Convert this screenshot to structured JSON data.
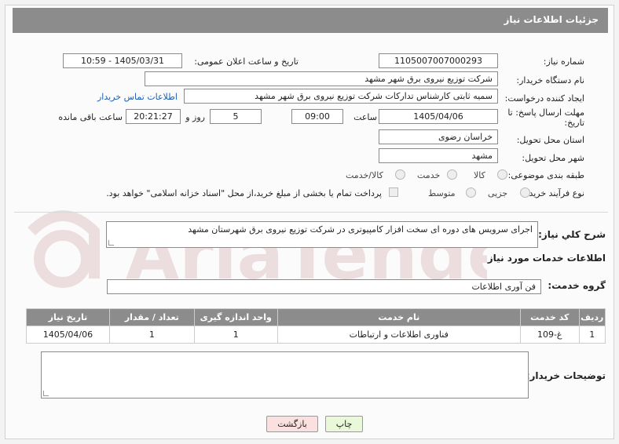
{
  "header": {
    "title": "جزئیات اطلاعات نیاز"
  },
  "info": {
    "need_number_label": "شماره نیاز:",
    "need_number": "1105007007000293",
    "announce_label": "تاریخ و ساعت اعلان عمومی:",
    "announce_value": "1405/03/31 - 10:59",
    "buyer_org_label": "نام دستگاه خریدار:",
    "buyer_org": "شرکت توزیع نیروی برق شهر مشهد",
    "creator_label": "ایجاد کننده درخواست:",
    "creator": "سمیه ثابتی کارشناس تدارکات شرکت توزیع نیروی برق شهر مشهد",
    "contact_link": "اطلاعات تماس خریدار",
    "deadline_label_1": "مهلت ارسال پاسخ: تا",
    "deadline_label_2": "تاریخ:",
    "deadline_date": "1405/04/06",
    "time_label": "ساعت",
    "deadline_time": "09:00",
    "days_value": "5",
    "days_label": "روز و",
    "remaining_time": "20:21:27",
    "remaining_label": "ساعت باقی مانده",
    "province_label": "استان محل تحویل:",
    "province": "خراسان رضوی",
    "city_label": "شهر محل تحویل:",
    "city": "مشهد",
    "category_label": "طبقه بندی موضوعی:",
    "category_options": [
      "کالا",
      "خدمت",
      "کالا/خدمت"
    ],
    "purchase_label": "نوع فرآیند خرید :",
    "purchase_options": [
      "جزیی",
      "متوسط"
    ],
    "payment_note": "پرداخت تمام یا بخشی از مبلغ خرید،از محل \"اسناد خزانه اسلامی\" خواهد بود."
  },
  "description": {
    "label": "شرح کلي نياز:",
    "text": "اجرای سرویس های دوره ای سخت افزار کامپیوتری  در شرکت توزیع نیروی برق شهرستان مشهد"
  },
  "services": {
    "section_title": "اطلاعات خدمات مورد نیاز",
    "group_label": "گروه خدمت:",
    "group_value": "فن آوری اطلاعات",
    "columns": [
      "ردیف",
      "کد خدمت",
      "نام خدمت",
      "واحد اندازه گیری",
      "تعداد / مقدار",
      "تاریخ نیاز"
    ],
    "rows": [
      [
        "1",
        "غ-109",
        "فناوری اطلاعات و ارتباطات",
        "1",
        "1",
        "1405/04/06"
      ]
    ]
  },
  "buyer_notes": {
    "label": "توضیحات خریدار:",
    "text": ""
  },
  "buttons": {
    "print": "چاپ",
    "back": "بازگشت"
  },
  "watermark": {
    "text": "AriaTender.net"
  }
}
